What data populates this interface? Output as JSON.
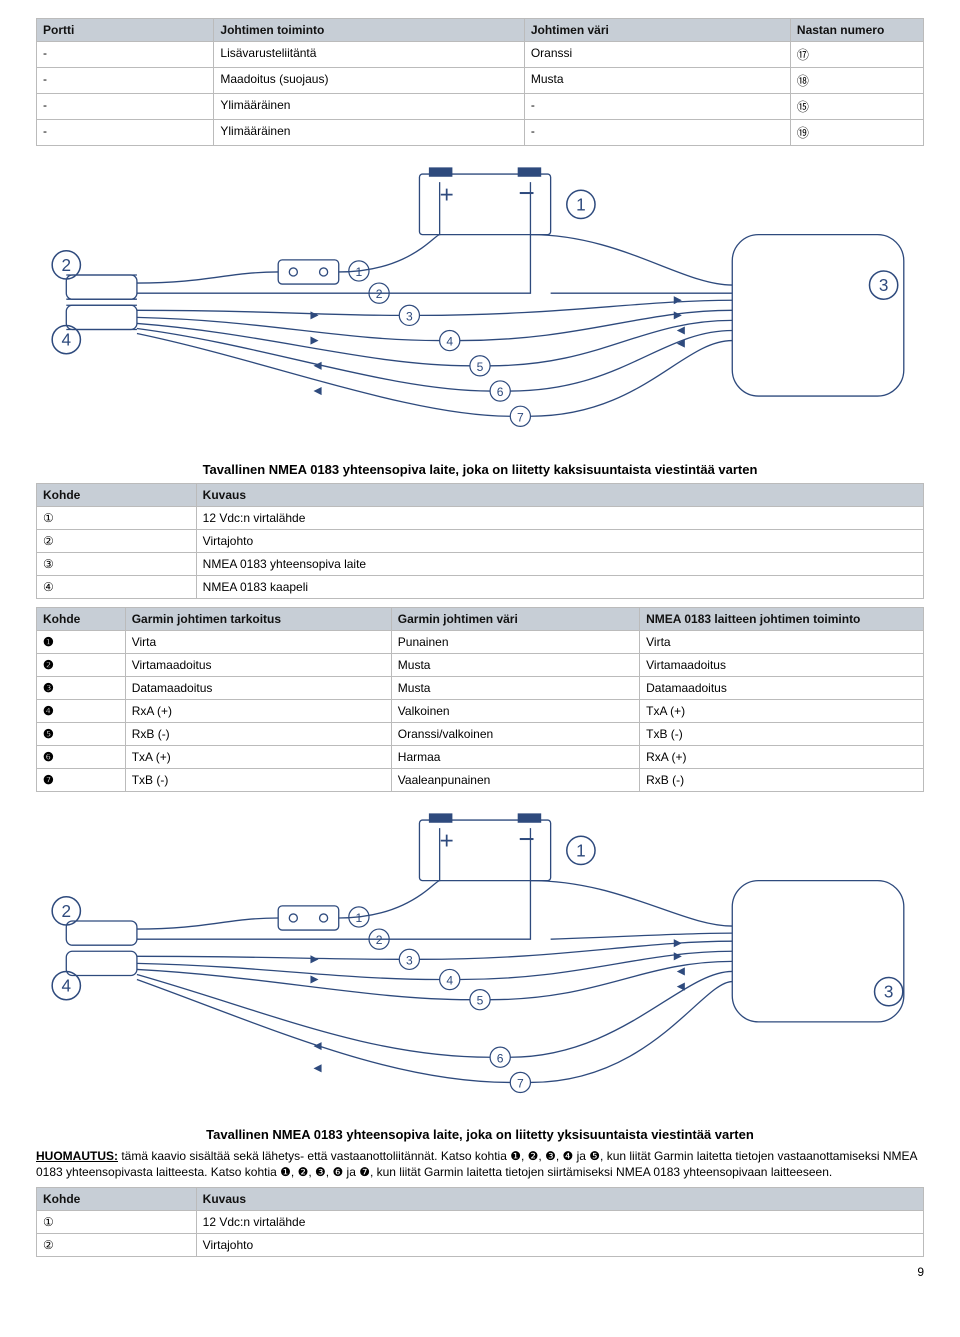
{
  "table1": {
    "headers": [
      "Portti",
      "Johtimen toiminto",
      "Johtimen väri",
      "Nastan numero"
    ],
    "rows": [
      [
        "-",
        "Lisävarusteliitäntä",
        "Oranssi",
        "⑰"
      ],
      [
        "-",
        "Maadoitus (suojaus)",
        "Musta",
        "⑱"
      ],
      [
        "-",
        "Ylimääräinen",
        "-",
        "⑮"
      ],
      [
        "-",
        "Ylimääräinen",
        "-",
        "⑲"
      ]
    ]
  },
  "caption1": "Tavallinen NMEA 0183 yhteensopiva laite, joka on liitetty kaksisuuntaista viestintää varten",
  "table2": {
    "headers": [
      "Kohde",
      "Kuvaus"
    ],
    "rows": [
      [
        "①",
        "12 Vdc:n virtalähde"
      ],
      [
        "②",
        "Virtajohto"
      ],
      [
        "③",
        "NMEA 0183 yhteensopiva laite"
      ],
      [
        "④",
        "NMEA 0183 kaapeli"
      ]
    ]
  },
  "table3": {
    "headers": [
      "Kohde",
      "Garmin johtimen tarkoitus",
      "Garmin johtimen väri",
      "NMEA 0183 laitteen johtimen toiminto"
    ],
    "rows": [
      [
        "❶",
        "Virta",
        "Punainen",
        "Virta"
      ],
      [
        "❷",
        "Virtamaadoitus",
        "Musta",
        "Virtamaadoitus"
      ],
      [
        "❸",
        "Datamaadoitus",
        "Musta",
        "Datamaadoitus"
      ],
      [
        "❹",
        "RxA (+)",
        "Valkoinen",
        "TxA (+)"
      ],
      [
        "❺",
        "RxB (-)",
        "Oranssi/valkoinen",
        "TxB (-)"
      ],
      [
        "❻",
        "TxA (+)",
        "Harmaa",
        "RxA (+)"
      ],
      [
        "❼",
        "TxB (-)",
        "Vaaleanpunainen",
        "RxB (-)"
      ]
    ]
  },
  "caption2": "Tavallinen NMEA 0183 yhteensopiva laite, joka on liitetty yksisuuntaista viestintää varten",
  "huomautus_label": "HUOMAUTUS:",
  "huomautus_text": " tämä kaavio sisältää sekä lähetys- että vastaanottoliitännät. Katso kohtia ❶, ❷, ❸, ❹ ja ❺, kun liität Garmin laitetta tietojen vastaanottamiseksi NMEA 0183 yhteensopivasta laitteesta. Katso kohtia ❶, ❷, ❸, ❻ ja ❼, kun liität Garmin laitetta tietojen siirtämiseksi NMEA 0183 yhteensopivaan laitteeseen.",
  "table4": {
    "headers": [
      "Kohde",
      "Kuvaus"
    ],
    "rows": [
      [
        "①",
        "12 Vdc:n virtalähde"
      ],
      [
        "②",
        "Virtajohto"
      ]
    ]
  },
  "pagenum": "9"
}
